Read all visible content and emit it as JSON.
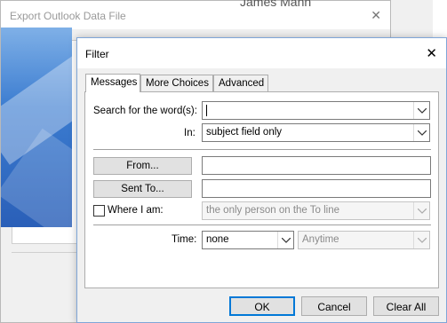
{
  "background_window": {
    "title": "Export Outlook Data File",
    "behind_name": "James Mann"
  },
  "filter_dialog": {
    "title": "Filter",
    "tabs": [
      {
        "label": "Messages",
        "active": true
      },
      {
        "label": "More Choices",
        "active": false
      },
      {
        "label": "Advanced",
        "active": false
      }
    ],
    "search_label": "Search for the word(s):",
    "search_value": "",
    "in_label": "In:",
    "in_value": "subject field only",
    "from_button": "From...",
    "from_value": "",
    "sent_to_button": "Sent To...",
    "sent_to_value": "",
    "where_label": "Where I am:",
    "where_checked": false,
    "where_value": "the only person on the To line",
    "time_label": "Time:",
    "time_value": "none",
    "time_range_value": "Anytime",
    "buttons": {
      "ok": "OK",
      "cancel": "Cancel",
      "clear_all": "Clear All"
    }
  },
  "colors": {
    "dialog_border": "#7fa6d8",
    "default_button_border": "#0078d7"
  },
  "icons": {
    "close": "close-icon",
    "dropdown": "chevron-down-icon"
  }
}
